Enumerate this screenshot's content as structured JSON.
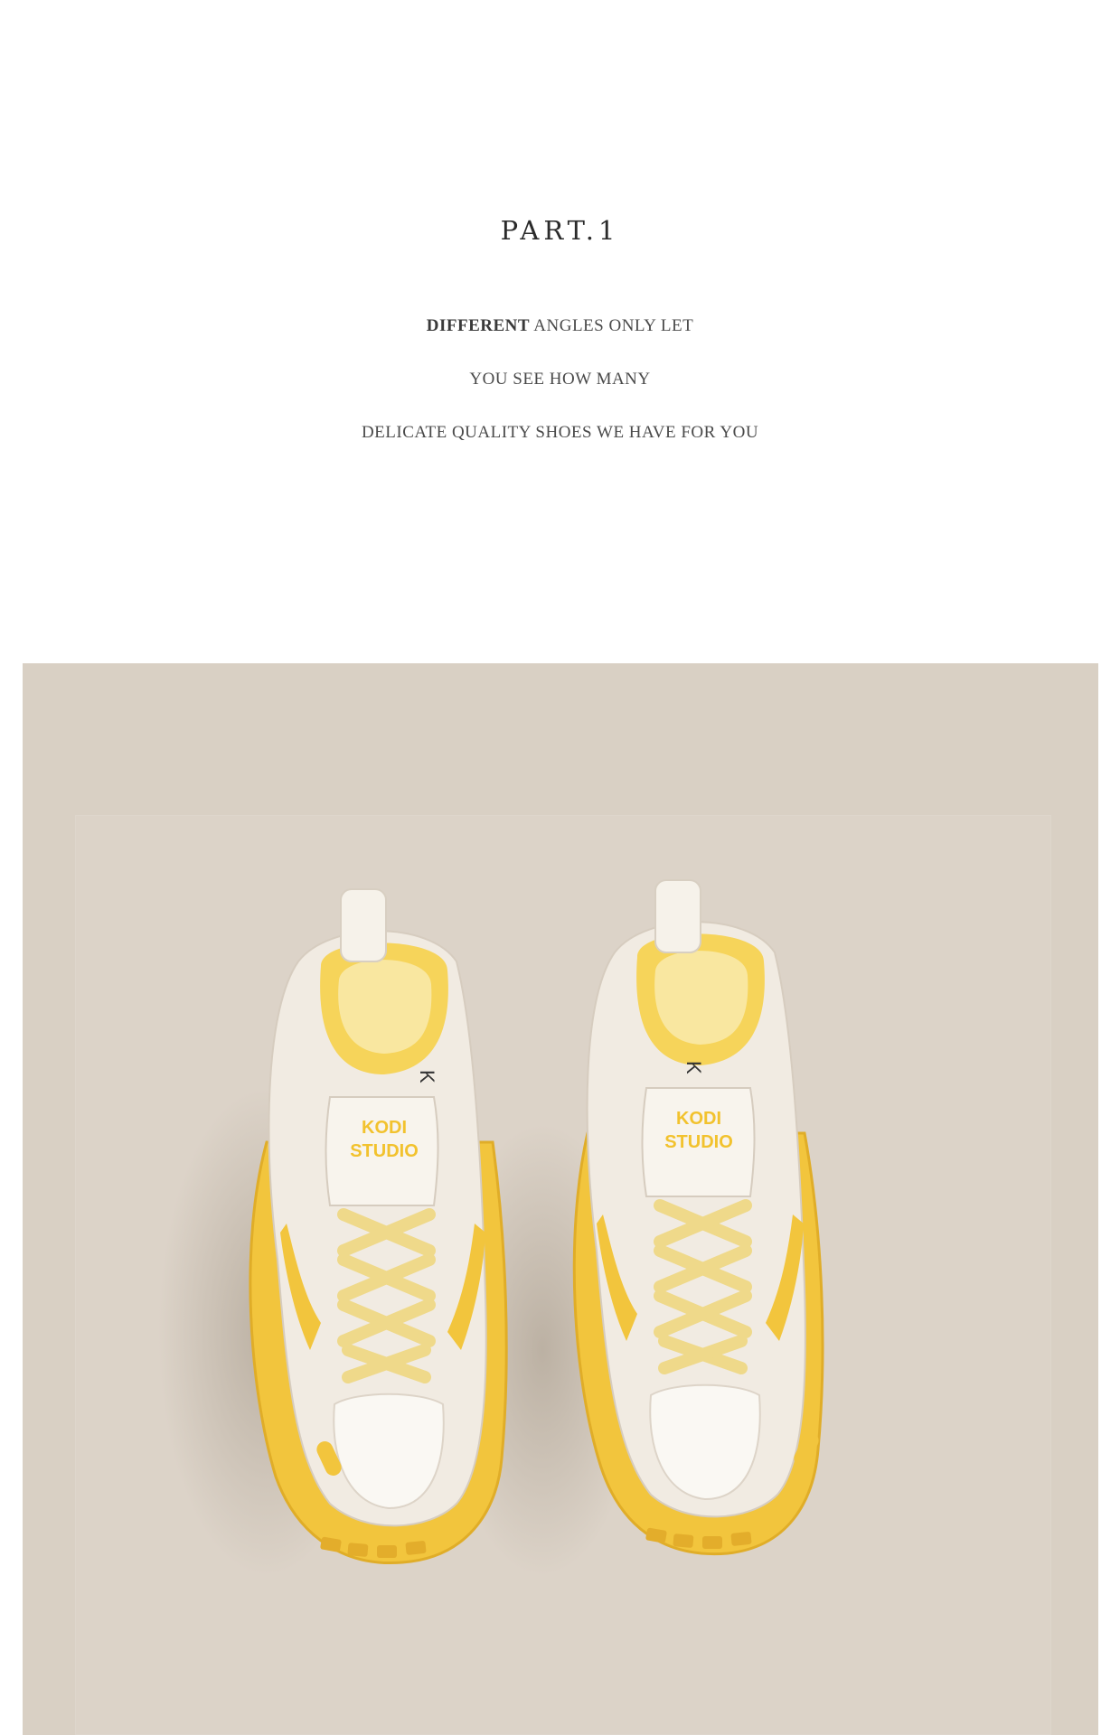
{
  "header": {
    "title": "PART.1",
    "lines": {
      "line1_emphasis": "DIFFERENT",
      "line1_rest": "ANGLES ONLY LET",
      "line2": "YOU SEE HOW MANY",
      "line3": "DELICATE QUALITY SHOES WE HAVE FOR YOU"
    }
  },
  "product_image": {
    "description_icon": "sneakers-photo",
    "tongue_label": "KODI STUDIO",
    "insole_text": "K",
    "colors": {
      "backdrop": "#d9d0c4",
      "sole": "#f2c53d",
      "upper": "#f1ebe2",
      "laces": "#f0dc8a"
    }
  }
}
